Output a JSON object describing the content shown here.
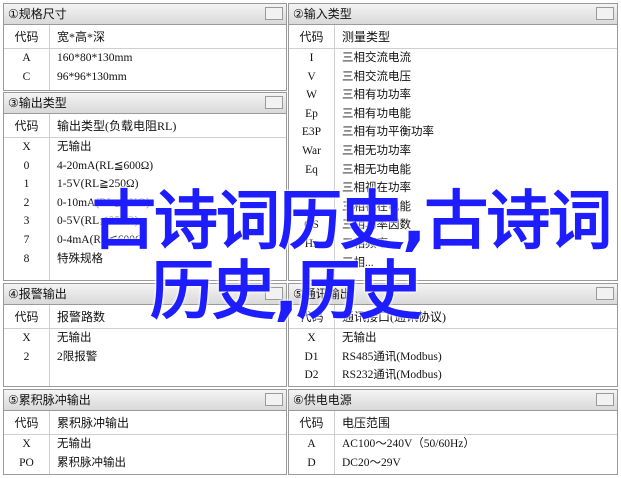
{
  "panels": [
    {
      "title": "①规格尺寸",
      "col1": "代码",
      "col2": "宽*高*深",
      "rows": [
        [
          "A",
          "160*80*130mm"
        ],
        [
          "C",
          "96*96*130mm"
        ]
      ]
    },
    {
      "title": "②输入类型",
      "col1": "代码",
      "col2": "测量类型",
      "rows": [
        [
          "I",
          "三相交流电流"
        ],
        [
          "V",
          "三相交流电压"
        ],
        [
          "W",
          "三相有功功率"
        ],
        [
          "Ep",
          "三相有功电能"
        ],
        [
          "E3P",
          "三相有功平衡功率"
        ],
        [
          "War",
          "三相无功功率"
        ],
        [
          "Eq",
          "三相无功电能"
        ],
        [
          "",
          "三相视在功率"
        ],
        [
          "",
          "三相视在电能"
        ],
        [
          "OS",
          "三相功率因数"
        ],
        [
          "Hz",
          "三相频率"
        ],
        [
          "",
          "三相..."
        ]
      ]
    },
    {
      "title": "③输出类型",
      "col1": "代码",
      "col2": "输出类型(负载电阻RL)",
      "rows": [
        [
          "X",
          "无输出"
        ],
        [
          "0",
          "4-20mA(RL≦600Ω)"
        ],
        [
          "1",
          "1-5V(RL≧250Ω)"
        ],
        [
          "2",
          "0-10mA(RL≦1KΩ)"
        ],
        [
          "3",
          "0-5V(RL≦250Ω)"
        ],
        [
          "7",
          "0-4mA(RL≦600Ω)"
        ],
        [
          "8",
          "特殊规格"
        ]
      ]
    },
    {
      "title": "④报警输出",
      "col1": "代码",
      "col2": "报警路数",
      "rows": [
        [
          "X",
          "无输出"
        ],
        [
          "2",
          "2限报警"
        ]
      ]
    },
    {
      "title": "⑤通讯输出",
      "col1": "代码",
      "col2": "通讯接口(通讯协议)",
      "rows": [
        [
          "X",
          "无输出"
        ],
        [
          "D1",
          "RS485通讯(Modbus)"
        ],
        [
          "D2",
          "RS232通讯(Modbus)"
        ]
      ]
    },
    {
      "title": "⑤累积脉冲输出",
      "col1": "代码",
      "col2": "累积脉冲输出",
      "rows": [
        [
          "X",
          "无输出"
        ],
        [
          "PO",
          "累积脉冲输出"
        ]
      ]
    },
    {
      "title": "⑥供电电源",
      "col1": "代码",
      "col2": "电压范围",
      "rows": [
        [
          "A",
          "AC100～240V（50/60Hz）"
        ],
        [
          "D",
          "DC20～29V"
        ]
      ]
    }
  ],
  "watermark": {
    "line1": "古诗词历史,古诗词",
    "line2": "历史,历史",
    "color": "#1d1dff"
  }
}
